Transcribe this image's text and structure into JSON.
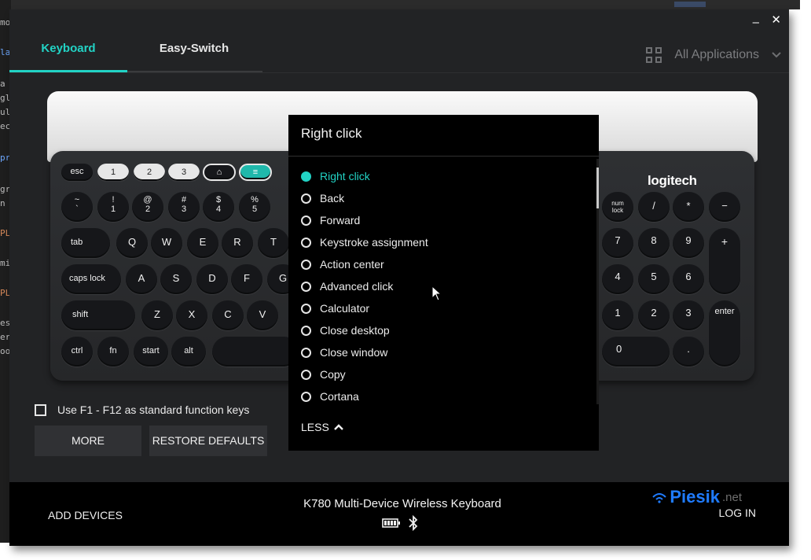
{
  "window": {
    "minimize": "–",
    "close": "✕"
  },
  "tabs": [
    {
      "label": "Keyboard",
      "active": true
    },
    {
      "label": "Easy-Switch",
      "active": false
    }
  ],
  "app_filter": {
    "label": "All Applications",
    "icon": "grid-icon"
  },
  "keyboard": {
    "brand": "logitech",
    "keys": {
      "esc": "esc",
      "tab": "tab",
      "caps": "caps lock",
      "shift": "shift",
      "ctrl": "ctrl",
      "fn": "fn",
      "start": "start",
      "alt": "alt",
      "q": "Q",
      "w": "W",
      "e": "E",
      "r": "R",
      "t": "T",
      "a": "A",
      "s": "S",
      "d": "D",
      "f": "F",
      "g": "G",
      "z": "Z",
      "x": "X",
      "c": "C",
      "v": "V",
      "enter": "enter",
      "plus": "+",
      "minus": "−",
      "slash": "/",
      "star": "*",
      "n7": "7",
      "n8": "8",
      "n9": "9",
      "n4": "4",
      "n5": "5",
      "n6": "6",
      "n1": "1",
      "n2": "2",
      "n3": "3",
      "n0": "0",
      "dot": "."
    }
  },
  "options": {
    "fn_label": "Use F1 - F12 as standard function keys",
    "more": "MORE",
    "restore": "RESTORE DEFAULTS"
  },
  "dropdown": {
    "title": "Right click",
    "items": [
      {
        "label": "Right click",
        "selected": true
      },
      {
        "label": "Back",
        "selected": false
      },
      {
        "label": "Forward",
        "selected": false
      },
      {
        "label": "Keystroke assignment",
        "selected": false
      },
      {
        "label": "Action center",
        "selected": false
      },
      {
        "label": "Advanced click",
        "selected": false
      },
      {
        "label": "Calculator",
        "selected": false
      },
      {
        "label": "Close desktop",
        "selected": false
      },
      {
        "label": "Close window",
        "selected": false
      },
      {
        "label": "Copy",
        "selected": false
      },
      {
        "label": "Cortana",
        "selected": false
      }
    ],
    "less": "LESS"
  },
  "bottom": {
    "add_devices": "ADD DEVICES",
    "device_name": "K780 Multi-Device Wireless Keyboard",
    "brand": "Piesik",
    "brand_tld": ".net",
    "login": "LOG IN"
  },
  "colors": {
    "accent": "#22d3c5",
    "background": "#222325",
    "dropdown": "#000000"
  }
}
